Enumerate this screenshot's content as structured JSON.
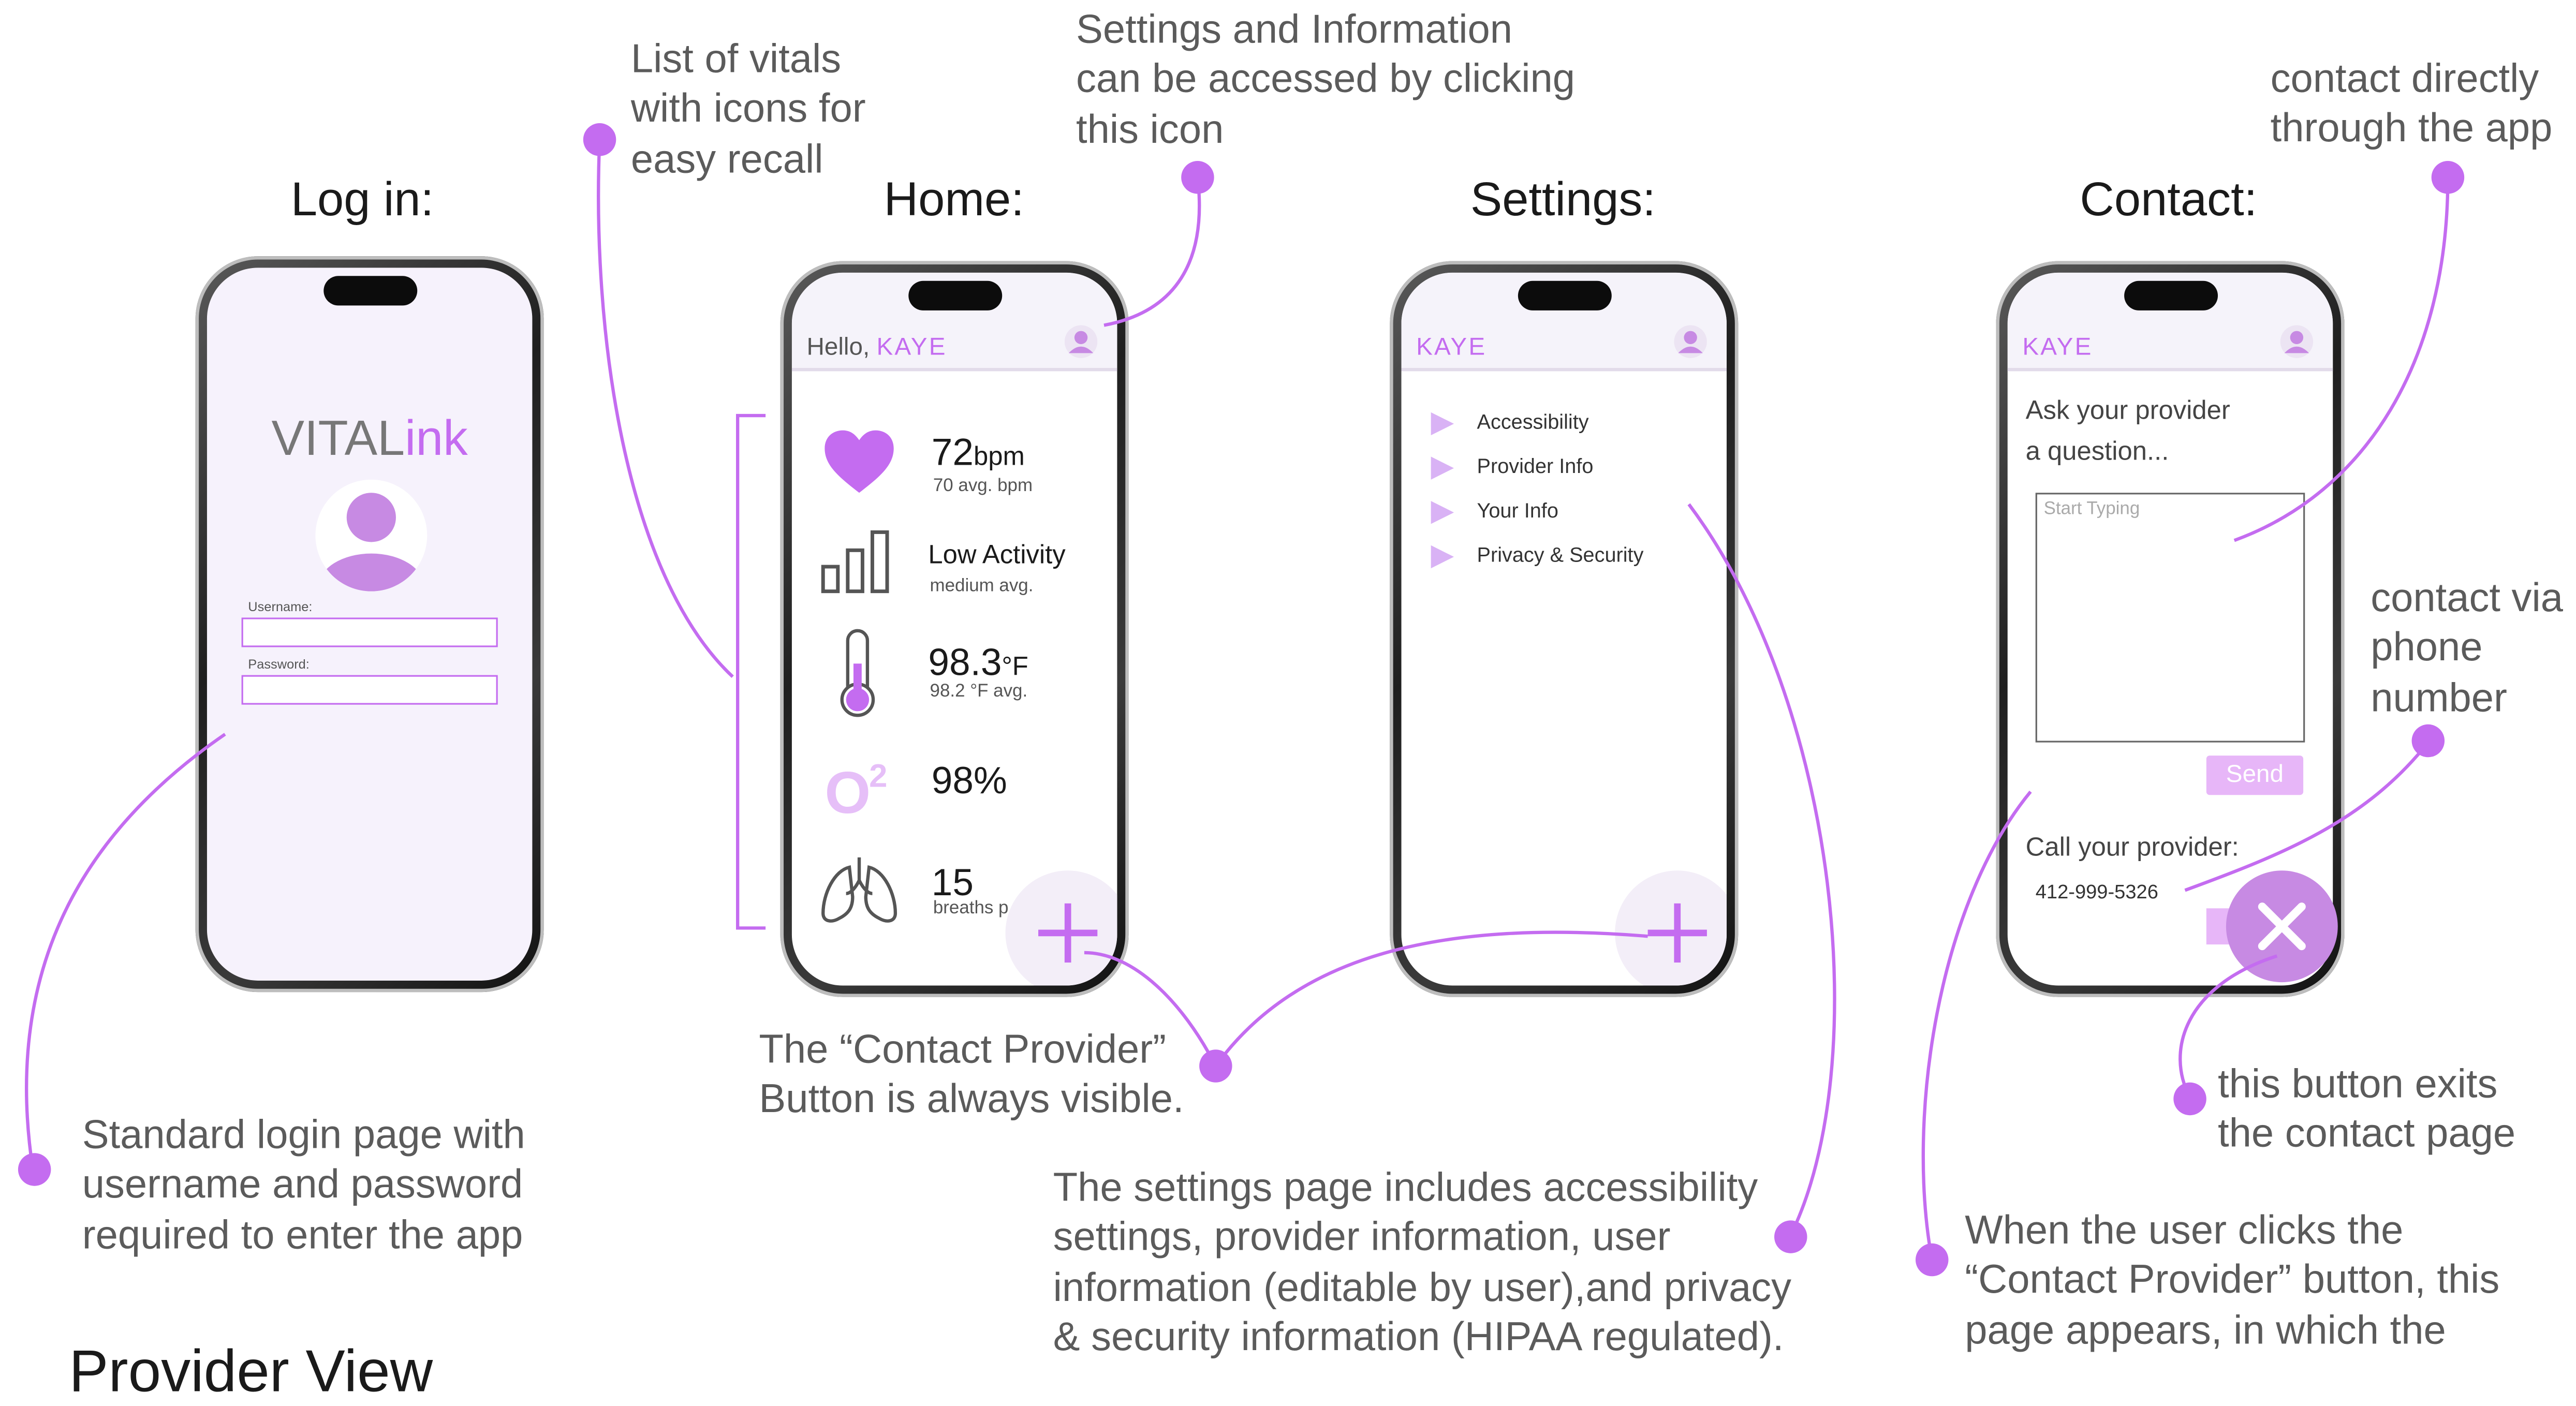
{
  "titles": {
    "login": "Log in:",
    "home": "Home:",
    "settings": "Settings:",
    "contact": "Contact:"
  },
  "notes": {
    "vitals_list": "List of vitals\nwith icons for\neasy recall",
    "settings_icon": "Settings and Information\ncan be accessed by clicking\nthis icon",
    "contact_app": "contact directly\nthrough the app",
    "contact_phone": "contact via\nphone\nnumber",
    "exit_button": "this button exits\nthe contact page",
    "login_page": "Standard login page with\nusername and password\nrequired to enter the app",
    "contact_button": "The “Contact Provider”\nButton is always visible.",
    "settings_page": "The settings page includes accessibility\nsettings, provider information, user\ninformation (editable by user),and privacy\n& security information (HIPAA regulated).",
    "contact_page": "When the user clicks the\n“Contact Provider” button, this\npage appears, in which the",
    "cut_heading": "Provider View"
  },
  "login": {
    "logo_main": "VITAL",
    "logo_accent": "ink",
    "username_label": "Username:",
    "password_label": "Password:"
  },
  "home": {
    "greeting": "Hello, ",
    "name": "KAYE",
    "vitals": [
      {
        "icon": "heart-icon",
        "value": "72",
        "unit": "bpm",
        "sub": "70 avg. bpm"
      },
      {
        "icon": "activity-bars-icon",
        "value": "Low Activity",
        "unit": "",
        "sub": "medium avg."
      },
      {
        "icon": "thermometer-icon",
        "value": "98.3",
        "unit": "°F",
        "sub": "98.2 °F avg."
      },
      {
        "icon": "oxygen-icon",
        "value": "98%",
        "unit": "",
        "sub": ""
      },
      {
        "icon": "lungs-icon",
        "value": "15",
        "unit": "",
        "sub": "breaths p"
      }
    ]
  },
  "settings": {
    "name": "KAYE",
    "items": [
      "Accessibility",
      "Provider Info",
      "Your Info",
      "Privacy & Security"
    ]
  },
  "contact": {
    "name": "KAYE",
    "prompt": "Ask your provider\na question...",
    "placeholder": "Start Typing",
    "send_label": "Send",
    "call_label": "Call your provider:",
    "phone": "412-999-5326"
  },
  "colors": {
    "accent": "#c46cf0",
    "light_accent": "#e2b3f7",
    "note_text": "#5b5b5b"
  }
}
